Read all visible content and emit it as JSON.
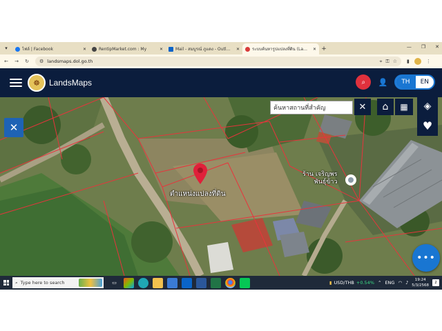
{
  "browser": {
    "tabs": [
      {
        "title": "ไฟล์ | Facebook",
        "favicon_color": "#1877f2",
        "active": false
      },
      {
        "title": "RentipMarket.com : My",
        "favicon_color": "#444444",
        "active": false
      },
      {
        "title": "Mail - สมบูรณ์ ภูแดง - Outlook",
        "favicon_color": "#0a64c8",
        "active": false
      },
      {
        "title": "ระบบค้นหารูปแปลงที่ดิน (LandsMa",
        "favicon_color": "#d83b3b",
        "active": true
      }
    ],
    "new_tab_label": "+",
    "url": "landsmaps.dol.go.th"
  },
  "app": {
    "brand": "LandsMaps",
    "lang_active": "TH",
    "lang_inactive": "EN"
  },
  "map": {
    "search_placeholder": "ค้นหาสถานที่สำคัญ",
    "close_label": "✕",
    "parcel_label": "ตำแหน่งแปลงที่ดิน",
    "poi_line1": "ร้าน เจริญพร",
    "poi_line2": "พันธุ์ข้าว",
    "more_label": "•••"
  },
  "taskbar": {
    "search_placeholder": "Type here to search",
    "ticker_pair": "USD/THB",
    "ticker_change": "+0.54%",
    "lang": "ENG",
    "time": "19:24",
    "date": "5/3/2568",
    "notification_count": "2"
  },
  "colors": {
    "header_bg": "#0b1d3d",
    "accent_blue": "#1976d2",
    "search_red": "#e0313d",
    "marker_red": "#e0203a",
    "parcel_line": "#e8343c"
  }
}
